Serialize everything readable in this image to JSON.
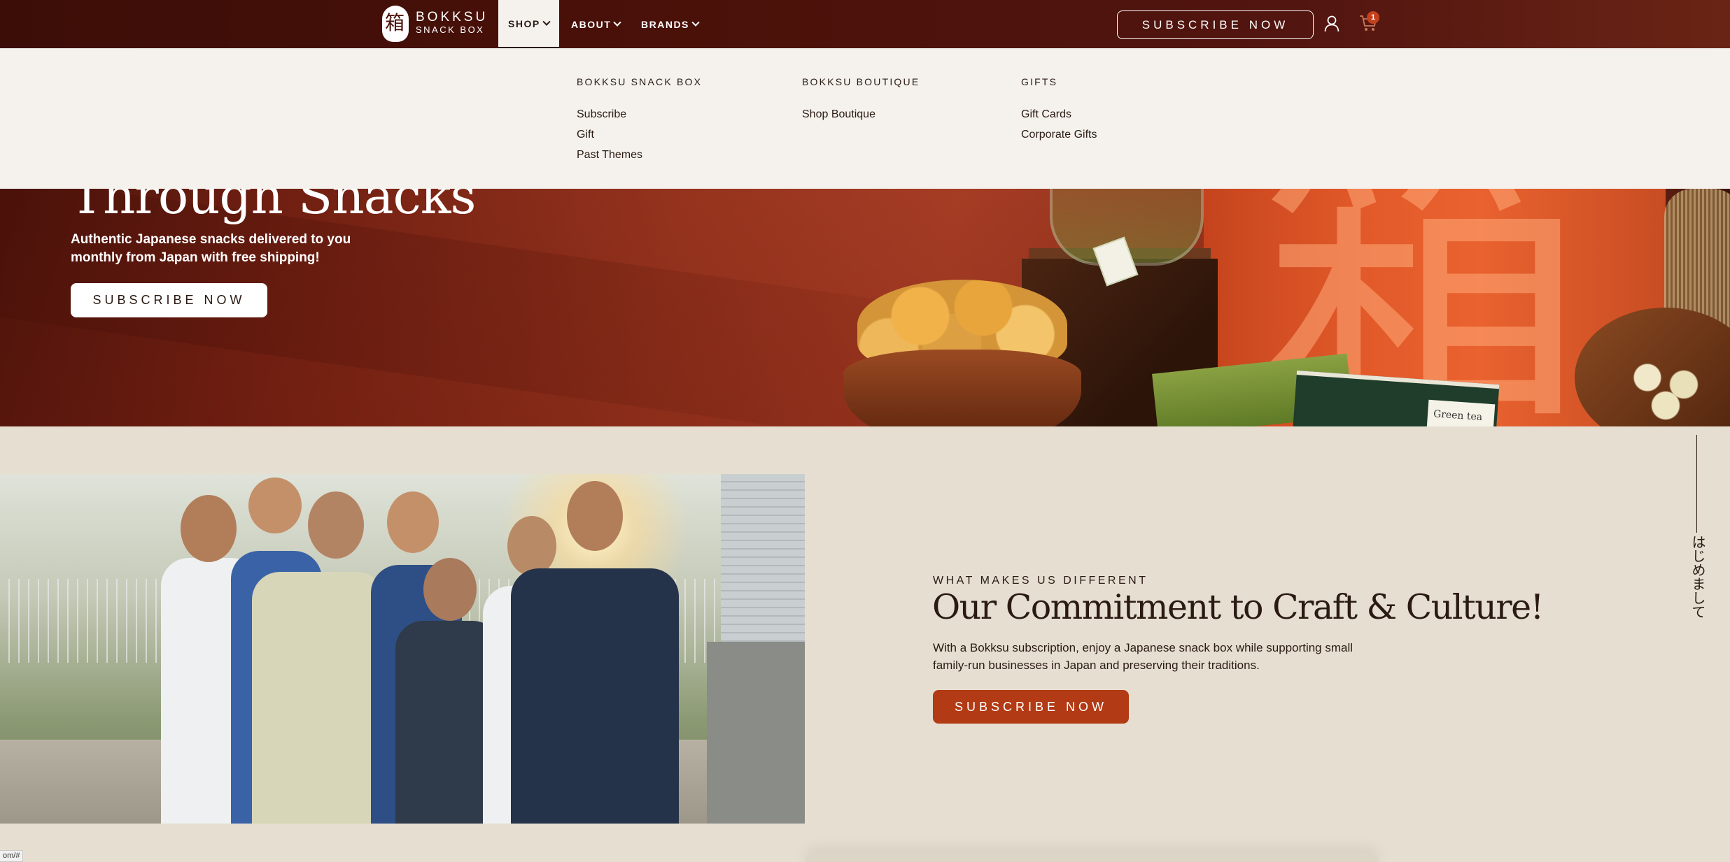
{
  "header": {
    "logo_line1": "BOKKSU",
    "logo_line2": "SNACK BOX",
    "logo_glyph": "箱",
    "nav": [
      {
        "label": "SHOP",
        "active": true
      },
      {
        "label": "ABOUT",
        "active": false
      },
      {
        "label": "BRANDS",
        "active": false
      }
    ],
    "subscribe_label": "SUBSCRIBE NOW",
    "cart_count": "1",
    "icons": [
      "user-icon",
      "cart-icon",
      "chevron-down-icon"
    ]
  },
  "mega_menu": {
    "columns": [
      {
        "heading": "BOKKSU SNACK BOX",
        "links": [
          "Subscribe",
          "Gift",
          "Past Themes"
        ]
      },
      {
        "heading": "BOKKSU BOUTIQUE",
        "links": [
          "Shop Boutique"
        ]
      },
      {
        "heading": "GIFTS",
        "links": [
          "Gift Cards",
          "Corporate Gifts"
        ]
      }
    ]
  },
  "hero": {
    "title": "Through Snacks",
    "subtitle": "Authentic Japanese snacks delivered to you monthly from Japan with free shipping!",
    "button_label": "SUBSCRIBE NOW",
    "box_kanji": "箱",
    "tea_label": "Green tea"
  },
  "about": {
    "eyebrow": "WHAT MAKES US DIFFERENT",
    "title": "Our Commitment to Craft & Culture!",
    "body": "With a Bokksu subscription, enjoy a Japanese snack box while supporting small family-run businesses in Japan and preserving their traditions.",
    "button_label": "SUBSCRIBE NOW",
    "vertical_text": "はじめまして"
  },
  "status_bar": {
    "url": "om/#"
  },
  "colors": {
    "header_bg": "#4a1109",
    "menu_bg": "#f5f2ee",
    "section_bg": "#e6dfd1",
    "accent_button": "#b23a14",
    "text_dark": "#2a1a12"
  }
}
